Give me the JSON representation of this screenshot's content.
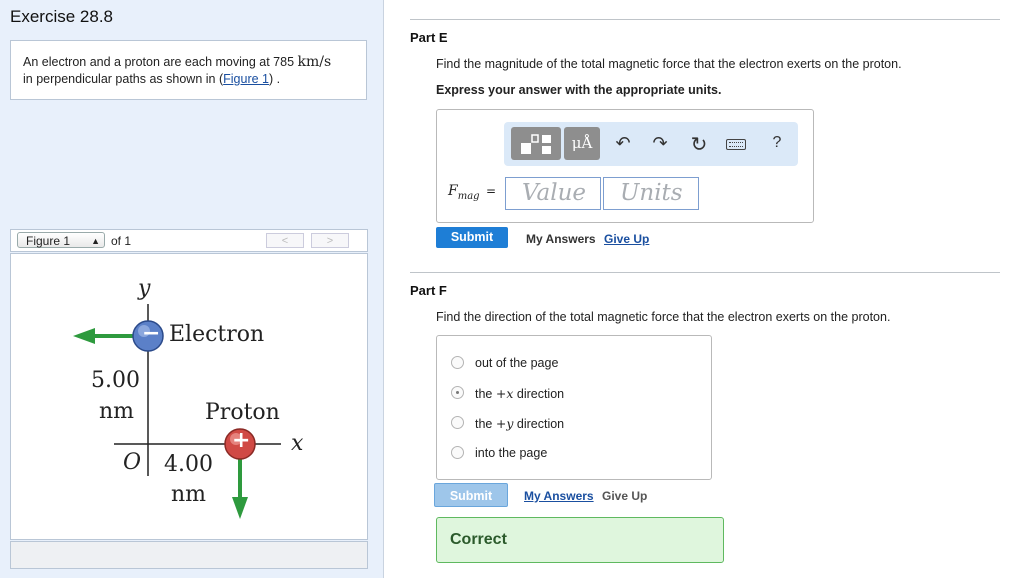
{
  "left": {
    "exercise_title": "Exercise 28.8",
    "problem": {
      "text_before": "An electron and a proton are each moving at 785 ",
      "speed_unit": "km/s",
      "text_after": "in perpendicular paths as shown in (",
      "figure_link": "Figure 1",
      "text_end": ") ."
    },
    "figure_nav": {
      "selected": "Figure 1",
      "of_text": "of 1",
      "prev": "<",
      "next": ">"
    },
    "figure": {
      "y_axis": "y",
      "x_axis": "x",
      "origin": "O",
      "electron_label": "Electron",
      "electron_sign": "−",
      "proton_label": "Proton",
      "proton_sign": "+",
      "dist_y_value": "5.00",
      "dist_y_unit": "nm",
      "dist_x_value": "4.00",
      "dist_x_unit": "nm",
      "arrow_color": "#2e9a3e"
    }
  },
  "partE": {
    "title": "Part E",
    "question": "Find the magnitude of the total magnetic force that the electron exerts on the proton.",
    "instruction": "Express your answer with the appropriate units.",
    "toolbar": {
      "templates_icon": "template-icon",
      "units_btn": "μÅ",
      "undo": "↶",
      "redo": "↷",
      "reset": "↻",
      "keyboard": "keyboard-icon",
      "help": "?"
    },
    "var_symbol": "F",
    "var_sub": "mag",
    "equals": "=",
    "value_placeholder": "Value",
    "units_placeholder": "Units",
    "submit": "Submit",
    "my_answers": "My Answers",
    "give_up": "Give Up"
  },
  "partF": {
    "title": "Part F",
    "question": "Find the direction of the total magnetic force that the electron exerts on the proton.",
    "options": [
      {
        "pre": "out of the page",
        "math": "",
        "post": ""
      },
      {
        "pre": "the ",
        "math": "+x",
        "post": " direction"
      },
      {
        "pre": "the ",
        "math": "+y",
        "post": " direction"
      },
      {
        "pre": "into the page",
        "math": "",
        "post": ""
      }
    ],
    "selected_index": 1,
    "submit": "Submit",
    "my_answers": "My Answers",
    "give_up": "Give Up",
    "feedback": "Correct"
  },
  "colors": {
    "left_bg": "#e8f0fb",
    "submit_blue": "#1e7ed6",
    "submit_disabled": "#9ec6ea",
    "link_blue": "#1a4fa0",
    "correct_bg": "#dff6dd"
  }
}
